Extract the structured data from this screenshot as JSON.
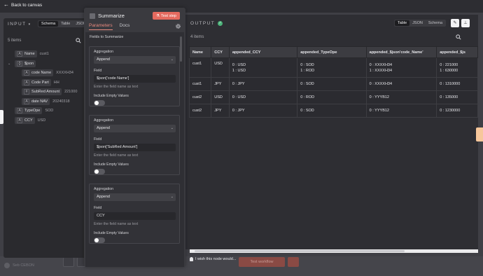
{
  "topbar": {
    "back_label": "Back to canvas"
  },
  "input_panel": {
    "heading": "INPUT",
    "view_tabs": [
      "Schema",
      "Table",
      "JSON"
    ],
    "items_count": "5 items",
    "schema": [
      {
        "type": "A",
        "key": "Name",
        "value": "cust1"
      },
      {
        "type": "{}",
        "key": "$json",
        "value": ""
      },
      {
        "type": "A",
        "key": "code Name",
        "value": "XXXXH34"
      },
      {
        "type": "A",
        "key": "Code Part",
        "value": "HH"
      },
      {
        "type": "#",
        "key": "SubRed Amount",
        "value": "221000"
      },
      {
        "type": "A",
        "key": "date NAV",
        "value": "20240318"
      },
      {
        "type": "A",
        "key": "TypeOpe",
        "value": "SOD"
      },
      {
        "type": "A",
        "key": "CCY",
        "value": "USD"
      }
    ]
  },
  "dialog": {
    "title": "Summarize",
    "test_step_label": "Test step",
    "tabs": [
      "Parameters",
      "Docs"
    ],
    "fields_title": "Fields to Summarize",
    "cards": [
      {
        "agg_label": "Aggregation",
        "agg_value": "Append",
        "field_label": "Field",
        "field_value": "$json['code Name']",
        "hint": "Enter the field name as text",
        "include_label": "Include Empty Values"
      },
      {
        "agg_label": "Aggregation",
        "agg_value": "Append",
        "field_label": "Field",
        "field_value": "$json['SubRed Amount']",
        "hint": "Enter the field name as text",
        "include_label": "Include Empty Values"
      },
      {
        "agg_label": "Aggregation",
        "agg_value": "Append",
        "field_label": "Field",
        "field_value": "CCY",
        "hint": "Enter the field name as text",
        "include_label": "Include Empty Values"
      }
    ]
  },
  "output_panel": {
    "heading": "OUTPUT",
    "view_tabs": [
      "Table",
      "JSON",
      "Schema"
    ],
    "items_count": "4 items",
    "columns": [
      "Name",
      "CCY",
      "appended_CCY",
      "appended_TypeOpe",
      "appended_$json'code_Name'",
      "appended_$js"
    ],
    "rows": [
      {
        "name": "cust1",
        "ccy": "USD",
        "app_ccy": [
          "0 : USD",
          "1 : USD"
        ],
        "app_type": [
          "0 : SOD",
          "1 : ROD"
        ],
        "app_code": [
          "0 : XXXXH34",
          "1 : XXXXH34"
        ],
        "app_js": [
          "0 : 221000",
          "1 : 630000"
        ]
      },
      {
        "name": "cust1",
        "ccy": "JPY",
        "app_ccy": [
          "0 : JPY"
        ],
        "app_type": [
          "0 : SOD"
        ],
        "app_code": [
          "0 : XXXXH34"
        ],
        "app_js": [
          "0 : 1310000"
        ]
      },
      {
        "name": "cust2",
        "ccy": "USD",
        "app_ccy": [
          "0 : USD"
        ],
        "app_type": [
          "0 : ROD"
        ],
        "app_code": [
          "0 : YYYB12"
        ],
        "app_js": [
          "0 : 135000"
        ]
      },
      {
        "name": "cust2",
        "ccy": "JPY",
        "app_ccy": [
          "0 : JPY"
        ],
        "app_type": [
          "0 : SOD"
        ],
        "app_code": [
          "0 : YYYB12"
        ],
        "app_js": [
          "0 : 1230000"
        ]
      }
    ],
    "feedback": "I wish this node would..."
  },
  "canvas": {
    "user_name": "Seb CEBON",
    "test_workflow_label": "Test workflow"
  },
  "colors": {
    "accent": "#e46a5f",
    "success": "#4cb37a",
    "panel_bg": "#2e2e33"
  }
}
